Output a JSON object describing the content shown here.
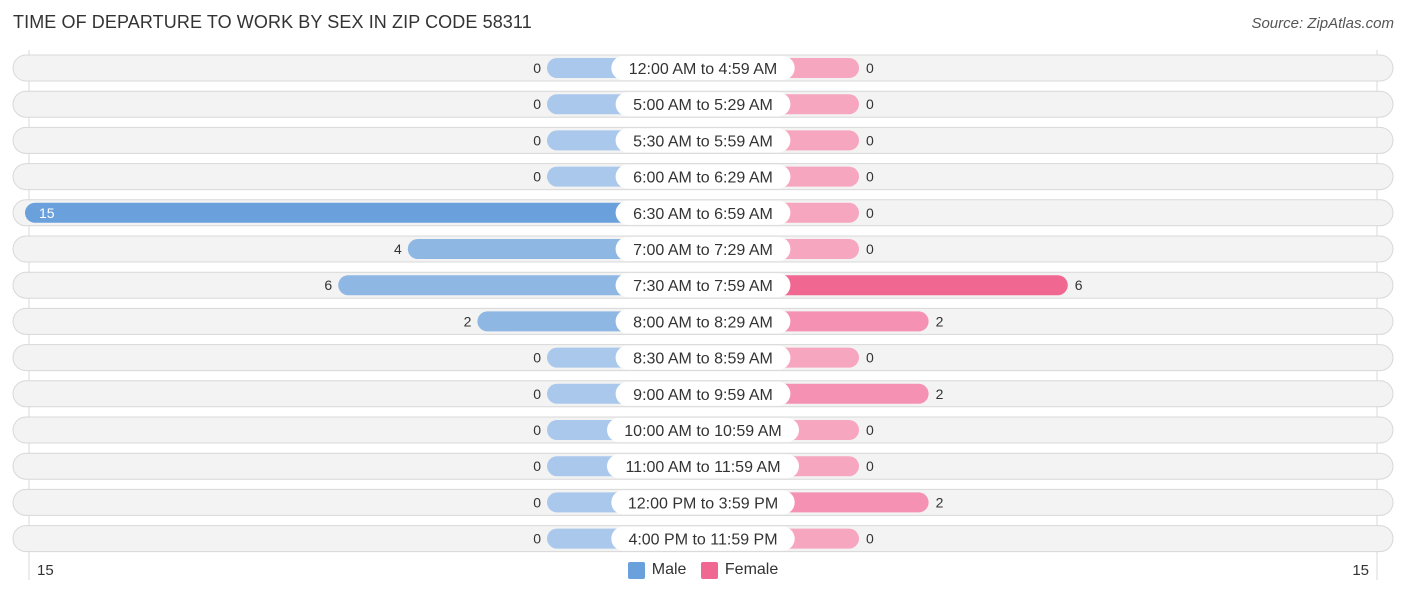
{
  "title": "TIME OF DEPARTURE TO WORK BY SEX IN ZIP CODE 58311",
  "source": "Source: ZipAtlas.com",
  "colors": {
    "male": "#6aa0dc",
    "male_light": "#a9c8ec",
    "female": "#f06892",
    "female_light": "#f7a6c0",
    "row_bg": "#f3f3f3",
    "row_border": "#d8d8d8"
  },
  "chart_data": {
    "type": "bar",
    "orientation": "horizontal-diverging",
    "title": "TIME OF DEPARTURE TO WORK BY SEX IN ZIP CODE 58311",
    "categories": [
      "12:00 AM to 4:59 AM",
      "5:00 AM to 5:29 AM",
      "5:30 AM to 5:59 AM",
      "6:00 AM to 6:29 AM",
      "6:30 AM to 6:59 AM",
      "7:00 AM to 7:29 AM",
      "7:30 AM to 7:59 AM",
      "8:00 AM to 8:29 AM",
      "8:30 AM to 8:59 AM",
      "9:00 AM to 9:59 AM",
      "10:00 AM to 10:59 AM",
      "11:00 AM to 11:59 AM",
      "12:00 PM to 3:59 PM",
      "4:00 PM to 11:59 PM"
    ],
    "series": [
      {
        "name": "Male",
        "values": [
          0,
          0,
          0,
          0,
          15,
          4,
          6,
          2,
          0,
          0,
          0,
          0,
          0,
          0
        ]
      },
      {
        "name": "Female",
        "values": [
          0,
          0,
          0,
          0,
          0,
          0,
          6,
          2,
          0,
          2,
          0,
          0,
          2,
          0
        ]
      }
    ],
    "xlim": [
      -15,
      15
    ],
    "axis_labels": {
      "left": "15",
      "right": "15"
    },
    "legend": {
      "entries": [
        "Male",
        "Female"
      ],
      "position": "bottom-center"
    }
  }
}
